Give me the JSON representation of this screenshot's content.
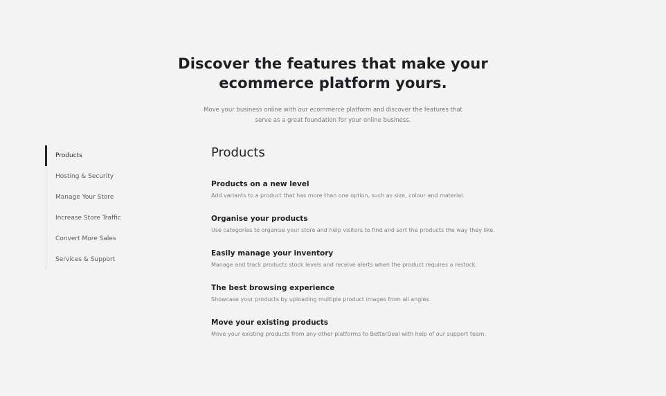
{
  "hero": {
    "title": "Discover the features that make your ecommerce platform yours.",
    "subtitle": "Move your business online with our ecommerce platform and discover the features that serve as a great foundation for your online business."
  },
  "sidebar": {
    "items": [
      {
        "label": "Products",
        "active": true
      },
      {
        "label": "Hosting & Security",
        "active": false
      },
      {
        "label": "Manage Your Store",
        "active": false
      },
      {
        "label": "Increase Store Traffic",
        "active": false
      },
      {
        "label": "Convert More Sales",
        "active": false
      },
      {
        "label": "Services & Support",
        "active": false
      }
    ]
  },
  "content": {
    "title": "Products",
    "features": [
      {
        "title": "Products on a new level",
        "description": "Add variants to a product that has more than one option, such as size, colour and material."
      },
      {
        "title": "Organise your products",
        "description": "Use categories to organise your store and help visitors to find and sort the products the way they like."
      },
      {
        "title": "Easily manage your inventory",
        "description": "Manage and track products stock levels and receive alerts when the product requires a restock."
      },
      {
        "title": "The best browsing experience",
        "description": "Showcase your products by uploading multiple product images from all angles."
      },
      {
        "title": "Move your existing products",
        "description": "Move your existing products from any other platforms to BetterDeal with help of our support team."
      }
    ]
  },
  "colors": {
    "background": "#f3f3f3",
    "text_primary": "#1f1f24",
    "text_muted": "#808080",
    "active_indicator": "#27272b"
  }
}
